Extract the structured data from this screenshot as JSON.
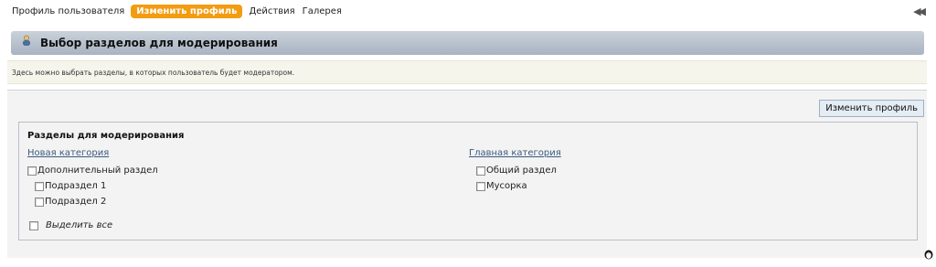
{
  "nav": {
    "profile": "Профиль пользователя",
    "edit_profile": "Изменить профиль",
    "actions": "Действия",
    "gallery": "Галерея",
    "back_icon": "double-arrow-left-icon"
  },
  "section": {
    "title": "Выбор разделов для модерирования",
    "icon": "user-icon",
    "description": "Здесь можно выбрать разделы, в которых пользователь будет модератором."
  },
  "form": {
    "submit_label": "Изменить профиль",
    "fieldset_title": "Разделы для модерирования",
    "categories": [
      {
        "name": "Новая категория",
        "forums": [
          {
            "label": "Дополнительный раздел",
            "checked": false
          },
          {
            "label": "Подраздел 1",
            "checked": false
          },
          {
            "label": "Подраздел 2",
            "checked": false
          }
        ]
      },
      {
        "name": "Главная категория",
        "forums": [
          {
            "label": "Общий раздел",
            "checked": false
          },
          {
            "label": "Мусорка",
            "checked": false
          }
        ]
      }
    ],
    "select_all": "Выделить все"
  },
  "colors": {
    "accent": "#f39c12",
    "link": "#3b5a80"
  },
  "corner_icon": "penguin-icon"
}
